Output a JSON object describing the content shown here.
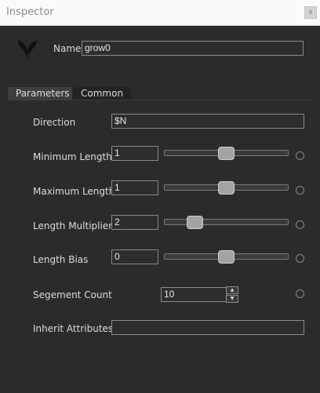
{
  "window": {
    "title": "Inspector",
    "close_glyph": "x"
  },
  "node": {
    "name_label": "Name",
    "name_value": "grow0",
    "icon": "leaf-icon"
  },
  "tabs": [
    {
      "label": "Parameters",
      "active": true
    },
    {
      "label": "Common",
      "active": false
    }
  ],
  "params": {
    "direction": {
      "label": "Direction",
      "value": "$N"
    },
    "min_length": {
      "label": "Minimum Length",
      "value": "1",
      "slider_level": 0.5
    },
    "max_length": {
      "label": "Maximum Length",
      "value": "1",
      "slider_level": 0.5
    },
    "length_multiplier": {
      "label": "Length Multiplier",
      "value": "2",
      "slider_level": 0.25
    },
    "length_bias": {
      "label": "Length Bias",
      "value": "0",
      "slider_level": 0.5
    },
    "segment_count": {
      "label": "Segement Count",
      "value": "10",
      "up_glyph": "▲",
      "down_glyph": "▼"
    },
    "inherit_attributes": {
      "label": "Inherit Attributes",
      "value": ""
    }
  }
}
